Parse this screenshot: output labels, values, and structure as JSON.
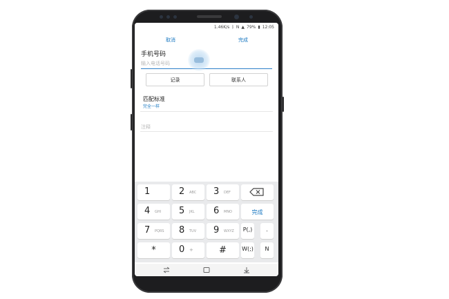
{
  "status": {
    "network_speed": "1.46K/s",
    "battery": "79%",
    "time": "12:05"
  },
  "actionbar": {
    "cancel_label": "取消",
    "done_label": "完成"
  },
  "form": {
    "phone_label": "手机号码",
    "phone_placeholder": "输入电话号码",
    "phone_value": "",
    "record_button": "记录",
    "contacts_button": "联系人",
    "match_label": "匹配标准",
    "match_value": "完全一样",
    "note_label": "注释"
  },
  "keypad": {
    "keys": [
      {
        "num": "1",
        "letters": ""
      },
      {
        "num": "2",
        "letters": "ABC"
      },
      {
        "num": "3",
        "letters": "DEF"
      },
      {
        "num": "4",
        "letters": "GHI"
      },
      {
        "num": "5",
        "letters": "JKL"
      },
      {
        "num": "6",
        "letters": "MNO"
      },
      {
        "num": "7",
        "letters": "PQRS"
      },
      {
        "num": "8",
        "letters": "TUV"
      },
      {
        "num": "9",
        "letters": "WXYZ"
      },
      {
        "num": "0",
        "letters": "+"
      }
    ],
    "star": "*",
    "hash": "#",
    "done_key": "完成",
    "pause_key": "P(,)",
    "wait_key": "W(;)",
    "dot_key": ".",
    "n_key": "N"
  },
  "colors": {
    "accent": "#1a78c2",
    "keypad_bg": "#e9eaec",
    "phone_body": "#1d1d1f"
  }
}
